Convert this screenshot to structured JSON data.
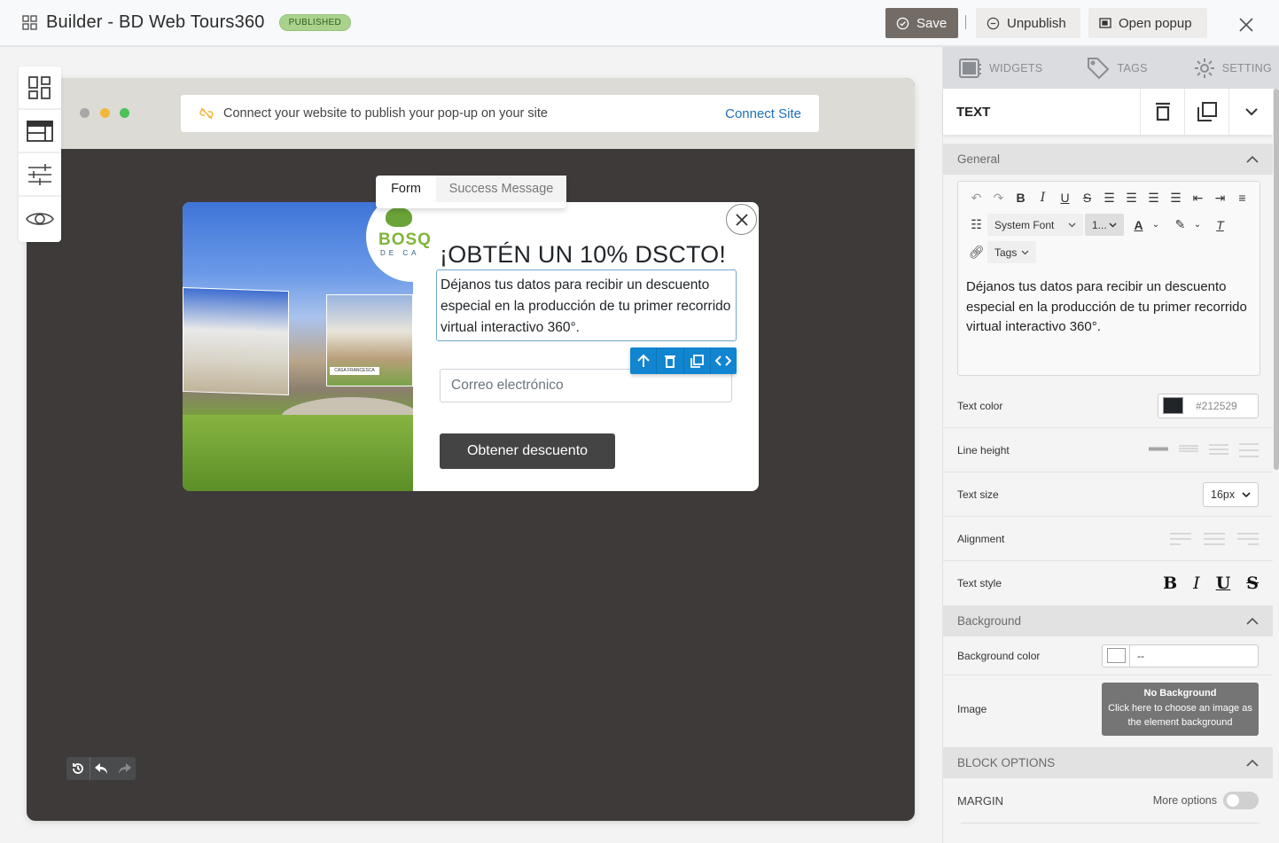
{
  "app": {
    "title": "Builder - BD Web Tours360",
    "status_badge": "PUBLISHED"
  },
  "toolbar": {
    "save_label": "Save",
    "unpublish_label": "Unpublish",
    "open_popup_label": "Open popup"
  },
  "left_tools": [
    {
      "name": "widgets-grid-icon"
    },
    {
      "name": "layout-icon"
    },
    {
      "name": "sliders-icon"
    },
    {
      "name": "eye-icon"
    }
  ],
  "preview": {
    "connect_message": "Connect your website to publish your pop-up on your site",
    "connect_link": "Connect Site",
    "tabs": [
      {
        "label": "Form",
        "active": true
      },
      {
        "label": "Success Message",
        "active": false
      }
    ],
    "popup": {
      "logo_text": "BOSQ",
      "logo_subtext": "DE CA",
      "image_sign": "CASA FRANCESCA",
      "headline": "¡OBTÉN UN 10% DSCTO!",
      "body_text": "Déjanos tus datos para recibir un descuento especial en la producción de tu primer recorrido virtual  interactivo 360°.",
      "email_placeholder": "Correo electrónico",
      "submit_label": "Obtener descuento"
    }
  },
  "panel": {
    "tabs": [
      {
        "label": "WIDGETS",
        "icon": "widgets-icon"
      },
      {
        "label": "TAGS",
        "icon": "tag-icon"
      },
      {
        "label": "SETTING",
        "icon": "gear-icon"
      }
    ],
    "element_name": "TEXT",
    "general_label": "General",
    "editor": {
      "font_select": "System Font",
      "size_select": "1...",
      "tags_select": "Tags",
      "content": "Déjanos tus datos para recibir un descuento especial en la producción de tu primer recorrido virtual  interactivo 360°."
    },
    "text_color_label": "Text color",
    "text_color_value": "#212529",
    "line_height_label": "Line height",
    "text_size_label": "Text size",
    "text_size_value": "16px",
    "alignment_label": "Alignment",
    "text_style_label": "Text style",
    "text_style_buttons": [
      "B",
      "I",
      "U",
      "S"
    ],
    "background_label": "Background",
    "background_color_label": "Background color",
    "background_color_value": "--",
    "image_label": "Image",
    "image_button_title": "No Background",
    "image_button_text": "Click here to choose an image as the element background",
    "block_options_label": "BLOCK OPTIONS",
    "margin_label": "MARGIN",
    "more_options_label": "More options",
    "more_options_enabled": false
  },
  "colors": {
    "save_button": "#736b66",
    "badge": "#a9d38d",
    "element_toolbar": "#1185d0",
    "link": "#1d6fb8",
    "canvas": "#3e3a39"
  }
}
